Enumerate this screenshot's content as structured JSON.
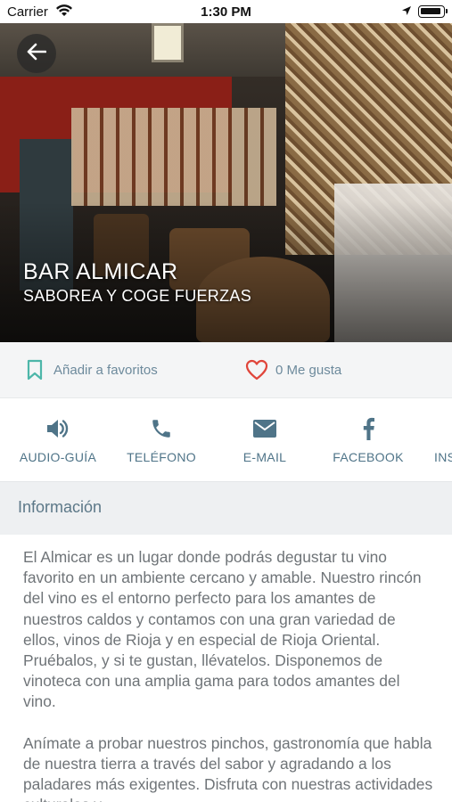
{
  "status_bar": {
    "carrier": "Carrier",
    "time": "1:30 PM"
  },
  "hero": {
    "title": "BAR ALMICAR",
    "subtitle": "SABOREA Y COGE FUERZAS"
  },
  "actions": {
    "favorite_label": "Añadir a favoritos",
    "likes_label": "0 Me gusta"
  },
  "contact": {
    "items": [
      {
        "label": "AUDIO-GUÍA",
        "icon": "speaker-icon"
      },
      {
        "label": "TELÉFONO",
        "icon": "phone-icon"
      },
      {
        "label": "E-MAIL",
        "icon": "mail-icon"
      },
      {
        "label": "FACEBOOK",
        "icon": "facebook-icon"
      },
      {
        "label": "INS",
        "icon": "instagram-icon"
      }
    ]
  },
  "info": {
    "header": "Información",
    "paragraphs": [
      "El Almicar es un lugar donde podrás degustar tu vino favorito en un ambiente cercano y amable. Nuestro rincón del vino es el entorno perfecto para los amantes de nuestros caldos y contamos con una gran variedad de ellos, vinos de Rioja y en especial de Rioja Oriental. Pruébalos, y si te gustan, llévatelos. Disponemos de vinoteca con una amplia gama para todos amantes del vino.",
      "Anímate a probar nuestros pinchos, gastronomía que habla de nuestra tierra a través del sabor y agradando a los paladares más exigentes. Disfruta con nuestras actividades culturales y"
    ]
  },
  "colors": {
    "accent": "#4f7488",
    "favorite_icon": "#4db6a9",
    "heart": "#e0453a"
  }
}
